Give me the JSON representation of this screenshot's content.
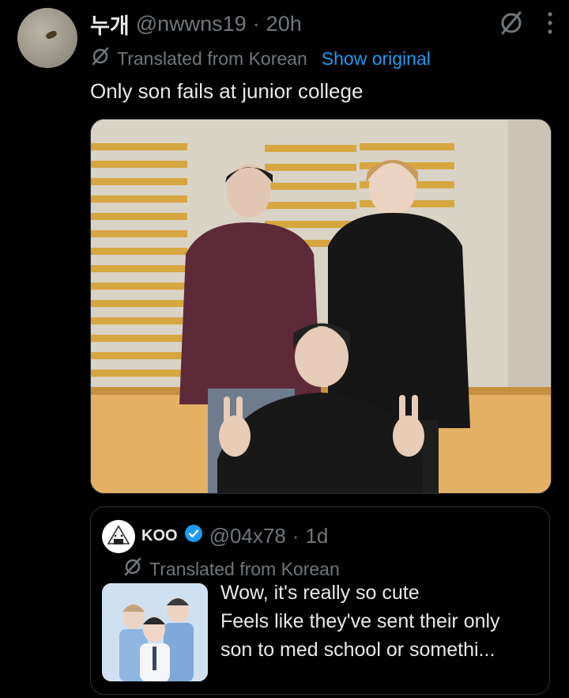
{
  "post": {
    "display_name": "누개",
    "handle": "@nwwns19",
    "separator": "·",
    "time": "20h",
    "translated_label": "Translated from Korean",
    "show_original_label": "Show original",
    "text": "Only son fails at junior college"
  },
  "quoted": {
    "display_name": "KOO",
    "verified_icon": "verified-badge-icon",
    "handle": "@04x78",
    "separator": "·",
    "time": "1d",
    "translated_label": "Translated from Korean",
    "text_lines": [
      "Wow, it's really so cute",
      "Feels like they've sent their only",
      "son to med school or somethi..."
    ]
  },
  "colors": {
    "background": "#000000",
    "text": "#e7e9ea",
    "muted": "#71767b",
    "link": "#1d9bf0",
    "border": "#2f3336"
  },
  "icons": [
    "grok-slash-icon",
    "more-vertical-icon",
    "translate-icon"
  ]
}
